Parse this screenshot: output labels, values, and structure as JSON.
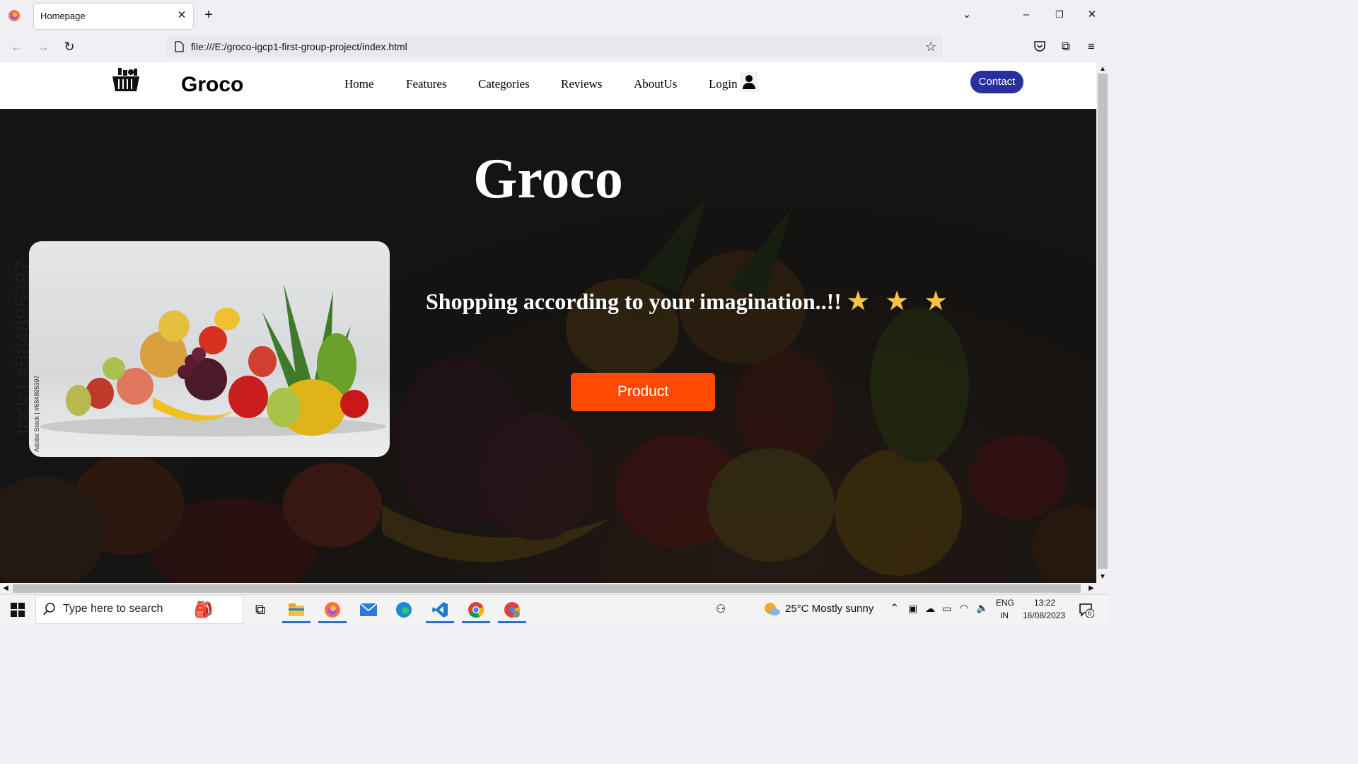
{
  "browser": {
    "tab_title": "Homepage",
    "url": "file:///E:/groco-igcp1-first-group-project/index.html"
  },
  "header": {
    "brand": "Groco",
    "nav": [
      "Home",
      "Features",
      "Categories",
      "Reviews",
      "AboutUs",
      "Login"
    ],
    "contact_label": "Contact"
  },
  "hero": {
    "title": "Groco",
    "tagline": "Shopping according to your imagination..!!",
    "stars": "★ ★ ★",
    "product_label": "Product",
    "card_watermark": "Adobe Stock | #684895397",
    "bg_watermark": "tock | #584895397"
  },
  "taskbar": {
    "search_placeholder": "Type here to search",
    "weather": "25°C  Mostly sunny",
    "lang_top": "ENG",
    "lang_bottom": "IN",
    "time": "13:22",
    "date": "16/08/2023",
    "notifications": "6"
  },
  "colors": {
    "contact_bg": "#2a2fa0",
    "product_bg": "#ff4a06",
    "star": "#f6c342"
  }
}
